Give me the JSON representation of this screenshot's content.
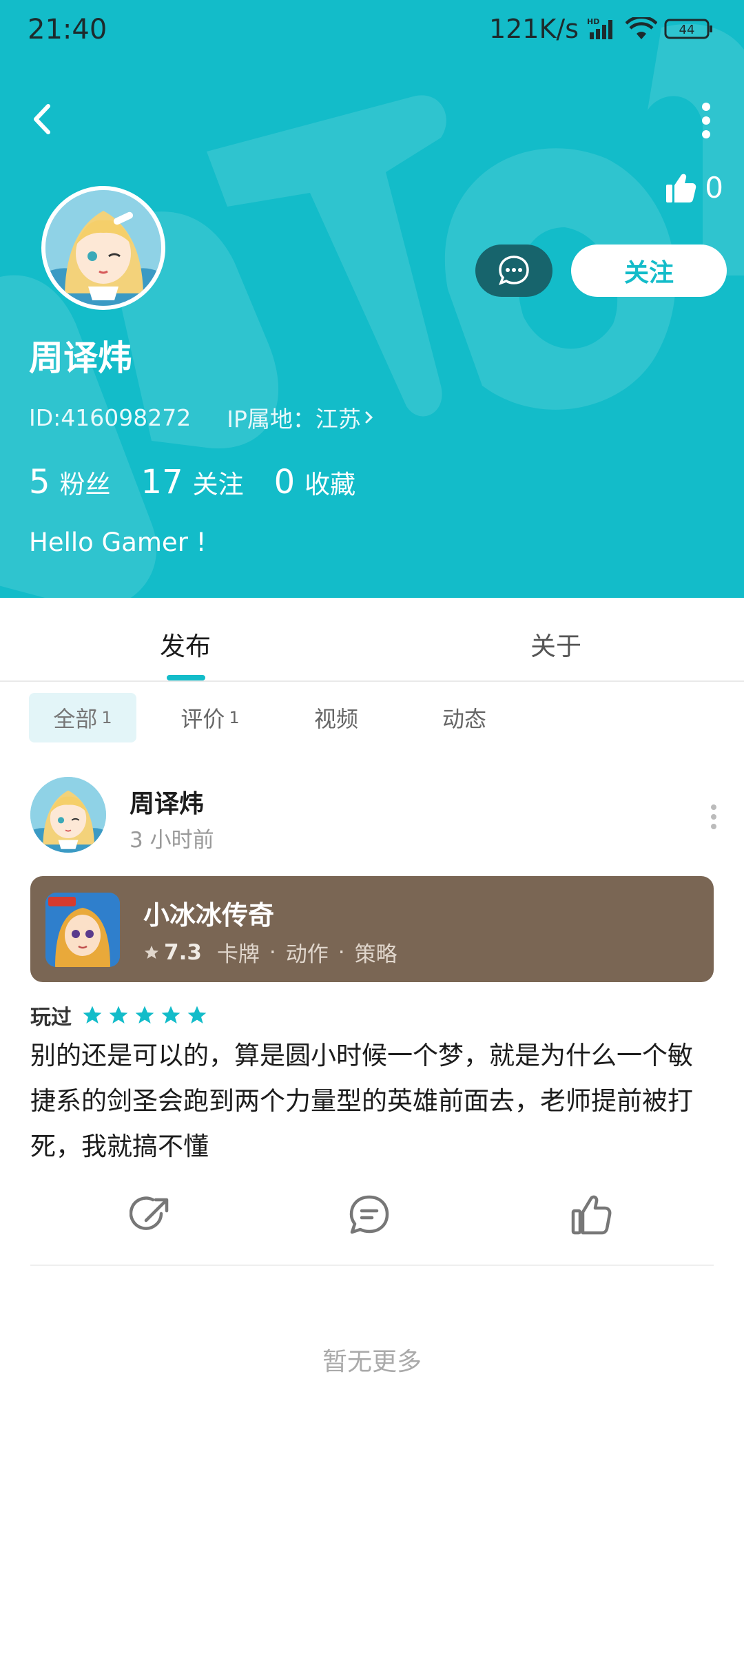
{
  "status_bar": {
    "time": "21:40",
    "speed": "121K/s",
    "network": "HD",
    "battery": "44"
  },
  "profile": {
    "name": "周译炜",
    "id_text": "ID:416098272",
    "ip_text": "IP属地：江苏",
    "likes": "0",
    "follow_label": "关注",
    "bio": "Hello Gamer !",
    "stats": [
      {
        "num": "5",
        "label": "粉丝"
      },
      {
        "num": "17",
        "label": "关注"
      },
      {
        "num": "0",
        "label": "收藏"
      }
    ]
  },
  "tabs": {
    "publish": "发布",
    "about": "关于"
  },
  "sub_tabs": {
    "all": "全部",
    "all_count": "1",
    "review": "评价",
    "review_count": "1",
    "video": "视频",
    "dynamic": "动态"
  },
  "post": {
    "author": "周译炜",
    "time": "3 小时前",
    "game": {
      "title": "小冰冰传奇",
      "score": "7.3",
      "tag1": "卡牌",
      "tag2": "动作",
      "tag3": "策略",
      "sep": "·"
    },
    "played_label": "玩过",
    "rating_stars": 5,
    "text": "别的还是可以的，算是圆小时候一个梦，就是为什么一个敏捷系的剑圣会跑到两个力量型的英雄前面去，老师提前被打死，我就搞不懂"
  },
  "footer": {
    "no_more": "暂无更多"
  },
  "colors": {
    "accent": "#13bcc9",
    "card": "#7a6654",
    "dark_btn": "#17646c"
  }
}
